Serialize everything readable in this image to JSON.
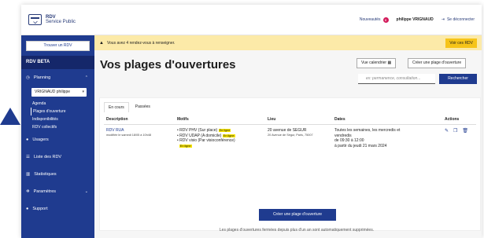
{
  "header": {
    "logo_line1": "RDV",
    "logo_line2": "Service Public",
    "news_label": "Nouveautés",
    "news_count": "8",
    "user_name": "philippe VRIGNAUD",
    "logout_label": "Se déconnecter"
  },
  "sidebar": {
    "find_button": "Trouver un RDV",
    "title": "RDV BETA",
    "planning_label": "Planning",
    "agent_select": "VRIGNAUD philippe",
    "planning_items": [
      {
        "label": "Agenda"
      },
      {
        "label": "Plages d'ouverture"
      },
      {
        "label": "Indisponibilités"
      },
      {
        "label": "RDV collectifs"
      }
    ],
    "usagers_label": "Usagers",
    "liste_rdv_label": "Liste des RDV",
    "statistiques_label": "Statistiques",
    "parametres_label": "Paramètres",
    "support_label": "Support"
  },
  "alert": {
    "text": "Vous avez 4 rendez-vous à renseigner.",
    "button": "Voir ces RDV"
  },
  "main": {
    "title": "Vos plages d'ouvertures",
    "calendar_button": "Vue calendrier",
    "create_button_top": "Créer une plage d'ouverture",
    "search_placeholder": "ex: permanence, consultation...",
    "search_button": "Rechercher",
    "tabs": [
      {
        "label": "En cours"
      },
      {
        "label": "Passées"
      }
    ],
    "columns": {
      "description": "Description",
      "motifs": "Motifs",
      "lieu": "Lieu",
      "dates": "Dates",
      "actions": "Actions"
    },
    "row": {
      "name": "RDV RUA",
      "modified": "modifiée le samedi 18/05 à 10h48",
      "motifs": [
        {
          "label": "RDV PHV (Sur place)",
          "tag": "En ligne"
        },
        {
          "label": "RDV UDAP (A domicile)",
          "tag": "En ligne"
        },
        {
          "label": "RDV visio (Par visioconférence)",
          "tag": "En ligne"
        }
      ],
      "lieu_name": "20 avenue de SEGUR",
      "lieu_address": "20 Avenue de Ségur, Paris, 75007",
      "dates_line1": "Toutes les semaines, les mercredis et",
      "dates_line2": "vendredis",
      "dates_line3": "de 09:30 à 12:00",
      "dates_line4": "à partir du jeudi 21 mars 2024"
    },
    "create_button_bottom": "Créer une plage d'ouverture",
    "footnote": "Les plages d'ouvertures fermées depuis plus d'un an sont automatiquement supprimées."
  },
  "colors": {
    "primary": "#1f3b8f",
    "alert_bg": "#fceaa8",
    "alert_button": "#f6c419",
    "tag_highlight": "#f6e300",
    "badge": "#d31b5b"
  }
}
